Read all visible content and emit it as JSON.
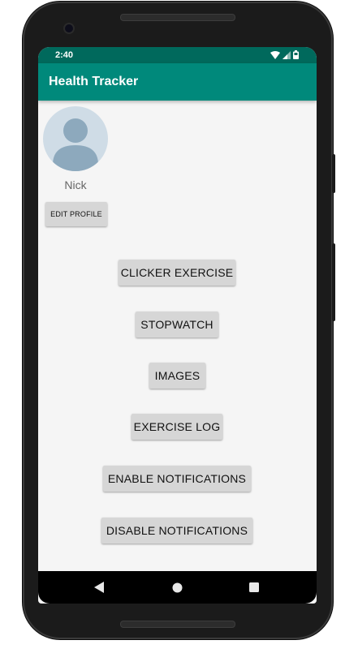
{
  "status_bar": {
    "time": "2:40",
    "icons": [
      "wifi-icon",
      "signal-icon",
      "battery-icon"
    ]
  },
  "app_bar": {
    "title": "Health Tracker"
  },
  "profile": {
    "avatar_icon": "person-avatar-icon",
    "name": "Nick",
    "edit_button_label": "EDIT PROFILE"
  },
  "menu": {
    "buttons": [
      {
        "label": "CLICKER EXERCISE"
      },
      {
        "label": "STOPWATCH"
      },
      {
        "label": "IMAGES"
      },
      {
        "label": "EXERCISE LOG"
      },
      {
        "label": "ENABLE NOTIFICATIONS"
      },
      {
        "label": "DISABLE NOTIFICATIONS"
      }
    ]
  },
  "nav_bar": {
    "icons": [
      "back-icon",
      "home-icon",
      "recents-icon"
    ]
  },
  "colors": {
    "status_bar": "#00695c",
    "app_bar": "#00897b",
    "background": "#f5f5f5",
    "button": "#d6d6d6"
  }
}
